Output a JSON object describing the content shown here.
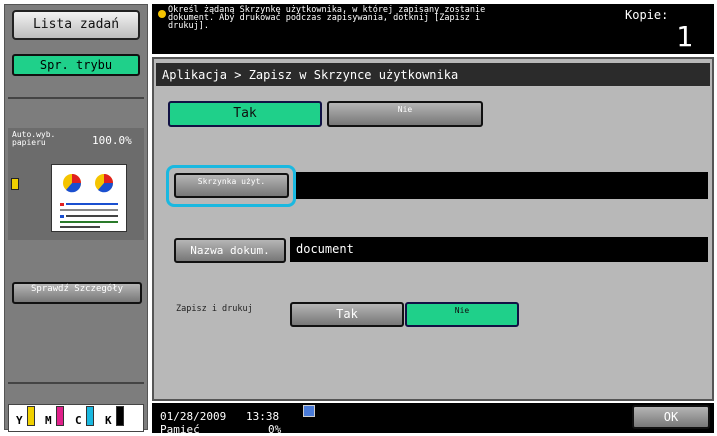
{
  "left": {
    "job_list_label": "Lista zadań",
    "mode_check_label": "Spr. trybu",
    "paper_label": "Auto.wyb. papieru",
    "zoom_value": "100.0%",
    "details_label": "Sprawdź Szczegóły",
    "toner": [
      "Y",
      "M",
      "C",
      "K"
    ]
  },
  "top": {
    "message": "Określ żądaną Skrzynkę użytkownika, w której zapisany zostanie dokument. Aby drukować podczas zapisywania, dotknij [Zapisz i drukuj].",
    "copies_label": "Kopie:",
    "copies_value": "1"
  },
  "content": {
    "title": "Aplikacja > Zapisz w Skrzynce użytkownika",
    "tab_yes": "Tak",
    "tab_no": "Nie",
    "user_box_btn": "Skrzynka użyt.",
    "user_box_value": "",
    "doc_name_btn": "Nazwa dokum.",
    "doc_name_value": "document",
    "save_print_label": "Zapisz i drukuj",
    "save_print_yes": "Tak",
    "save_print_no": "Nie"
  },
  "bottom": {
    "date": "01/28/2009",
    "time": "13:38",
    "memory_label": "Pamięć",
    "memory_value": "0%",
    "ok_label": "OK"
  },
  "colors": {
    "accent_green": "#1fd08a",
    "highlight_cyan": "#1ab8e0"
  }
}
